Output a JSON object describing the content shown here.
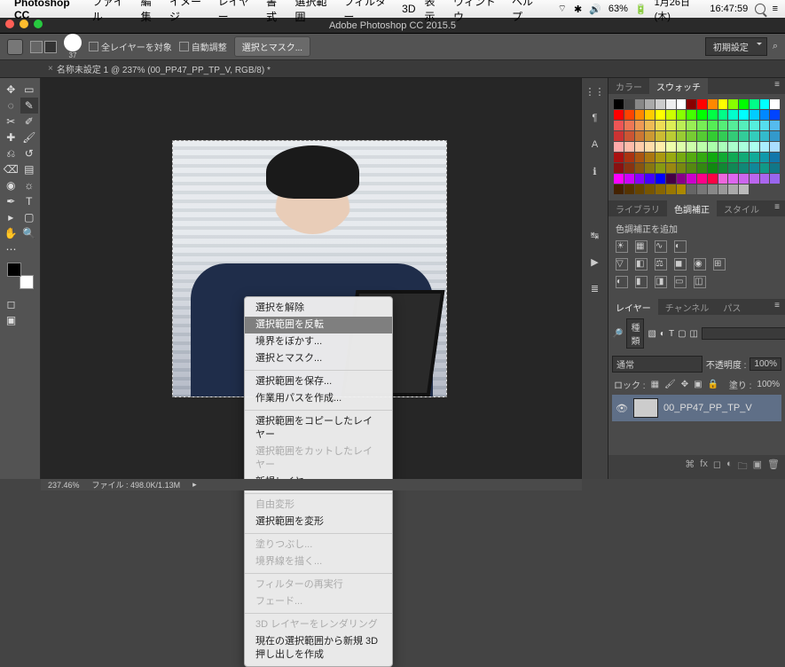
{
  "macbar": {
    "app": "Photoshop CC",
    "menus": [
      "ファイル",
      "編集",
      "イメージ",
      "レイヤー",
      "書式",
      "選択範囲",
      "フィルター",
      "3D",
      "表示",
      "ウィンドウ",
      "ヘルプ"
    ],
    "battery": "63%",
    "date": "1月26日(木)",
    "time": "16:47:59"
  },
  "window_title": "Adobe Photoshop CC 2015.5",
  "options_bar": {
    "all_layers_label": "全レイヤーを対象",
    "auto_adjust_label": "自動調整",
    "select_mask_btn": "選択とマスク...",
    "preset_label": "初期設定",
    "brush_size": "37"
  },
  "document_tab": "名称未設定 1 @ 237% (00_PP47_PP_TP_V, RGB/8) *",
  "context_menu": {
    "items": [
      {
        "label": "選択を解除",
        "state": "en"
      },
      {
        "label": "選択範囲を反転",
        "state": "hl"
      },
      {
        "label": "境界をぼかす...",
        "state": "en"
      },
      {
        "label": "選択とマスク...",
        "state": "en"
      },
      {
        "sep": true
      },
      {
        "label": "選択範囲を保存...",
        "state": "en"
      },
      {
        "label": "作業用パスを作成...",
        "state": "en"
      },
      {
        "sep": true
      },
      {
        "label": "選択範囲をコピーしたレイヤー",
        "state": "en"
      },
      {
        "label": "選択範囲をカットしたレイヤー",
        "state": "dis"
      },
      {
        "label": "新規レイヤー...",
        "state": "en"
      },
      {
        "sep": true
      },
      {
        "label": "自由変形",
        "state": "dis"
      },
      {
        "label": "選択範囲を変形",
        "state": "en"
      },
      {
        "sep": true
      },
      {
        "label": "塗りつぶし...",
        "state": "dis"
      },
      {
        "label": "境界線を描く...",
        "state": "dis"
      },
      {
        "sep": true
      },
      {
        "label": "フィルターの再実行",
        "state": "dis"
      },
      {
        "label": "フェード...",
        "state": "dis"
      },
      {
        "sep": true
      },
      {
        "label": "3D レイヤーをレンダリング",
        "state": "dis"
      },
      {
        "label": "現在の選択範囲から新規 3D 押し出しを作成",
        "state": "en"
      }
    ]
  },
  "panels": {
    "color_tab": "カラー",
    "swatch_tab": "スウォッチ",
    "library_tab": "ライブラリ",
    "adjust_tab": "色調補正",
    "style_tab": "スタイル",
    "adjust_add_label": "色調補正を追加",
    "layer_tab": "レイヤー",
    "channel_tab": "チャンネル",
    "path_tab": "パス",
    "layer_filter": "種類",
    "blend_mode": "通常",
    "opacity_label": "不透明度 :",
    "opacity_value": "100%",
    "lock_label": "ロック :",
    "fill_label": "塗り :",
    "fill_value": "100%",
    "layer_name": "00_PP47_PP_TP_V",
    "search_placeholder": ""
  },
  "status_bar": {
    "zoom": "237.46%",
    "doc_info": "ファイル : 498.0K/1.13M"
  },
  "swatch_colors": [
    [
      "#000",
      "#444",
      "#888",
      "#aaa",
      "#ccc",
      "#eee",
      "#fff",
      "#800",
      "#f00",
      "#f80",
      "#ff0",
      "#8f0",
      "#0f0",
      "#0f8",
      "#0ff",
      "#fff"
    ],
    [
      "#f00",
      "#f40",
      "#f80",
      "#fc0",
      "#ff0",
      "#cf0",
      "#8f0",
      "#4f0",
      "#0f0",
      "#0f4",
      "#0f8",
      "#0fc",
      "#0ff",
      "#0cf",
      "#08f",
      "#04f"
    ],
    [
      "#e55",
      "#e75",
      "#e95",
      "#eb5",
      "#ed5",
      "#de5",
      "#be5",
      "#9e5",
      "#7e5",
      "#5e5",
      "#5e7",
      "#5e9",
      "#5eb",
      "#5ed",
      "#5de",
      "#5be"
    ],
    [
      "#c33",
      "#c53",
      "#c73",
      "#c93",
      "#cb3",
      "#bc3",
      "#9c3",
      "#7c3",
      "#5c3",
      "#3c3",
      "#3c5",
      "#3c7",
      "#3c9",
      "#3cb",
      "#3bc",
      "#39c"
    ],
    [
      "#faa",
      "#fba",
      "#fca",
      "#fda",
      "#fea",
      "#efa",
      "#dfa",
      "#cfa",
      "#bfa",
      "#afa",
      "#afb",
      "#afc",
      "#afd",
      "#afe",
      "#aef",
      "#adf"
    ],
    [
      "#a11",
      "#a31",
      "#a51",
      "#a71",
      "#a91",
      "#9a1",
      "#7a1",
      "#5a1",
      "#3a1",
      "#1a1",
      "#1a3",
      "#1a5",
      "#1a7",
      "#1a9",
      "#19a",
      "#17a"
    ],
    [
      "#811",
      "#831",
      "#851",
      "#871",
      "#891",
      "#981",
      "#781",
      "#581",
      "#381",
      "#181",
      "#183",
      "#185",
      "#187",
      "#189",
      "#198",
      "#178"
    ],
    [
      "#f0f",
      "#c0f",
      "#80f",
      "#40f",
      "#00f",
      "#404",
      "#808",
      "#c0c",
      "#f08",
      "#f04",
      "#e6d",
      "#d6e",
      "#c6e",
      "#b6e",
      "#a6e",
      "#96e"
    ],
    [
      "#420",
      "#530",
      "#640",
      "#750",
      "#860",
      "#970",
      "#a80",
      "#666",
      "#777",
      "#888",
      "#999",
      "#aaa",
      "#bbb",
      "#4a4a4a",
      "#4a4a4a",
      "#4a4a4a"
    ]
  ]
}
